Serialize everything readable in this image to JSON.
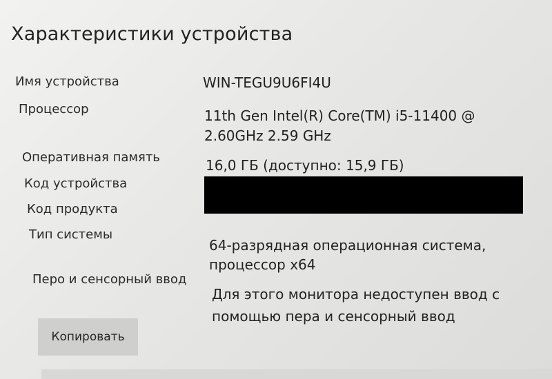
{
  "section": {
    "title": "Характеристики устройства"
  },
  "specs": [
    {
      "label": "Имя устройства",
      "value_lines": [
        "WIN-TEGU9U6FI4U"
      ]
    },
    {
      "label": "Процессор",
      "value_lines": [
        "11th Gen Intel(R) Core(TM) i5-11400 @",
        "2.60GHz   2.59 GHz"
      ]
    },
    {
      "label": "Оперативная память",
      "value_lines": [
        "16,0 ГБ (доступно: 15,9 ГБ)"
      ]
    },
    {
      "label": "Код устройства",
      "value_lines": []
    },
    {
      "label": "Код продукта",
      "value_lines": []
    },
    {
      "label": "Тип системы",
      "value_lines": [
        "64-разрядная операционная система,",
        "процессор x64"
      ]
    },
    {
      "label": "Перо и сенсорный ввод",
      "value_lines": [
        "Для этого монитора недоступен ввод с",
        "помощью пера и сенсорный ввод"
      ]
    }
  ],
  "actions": {
    "copy_label": "Копировать"
  }
}
